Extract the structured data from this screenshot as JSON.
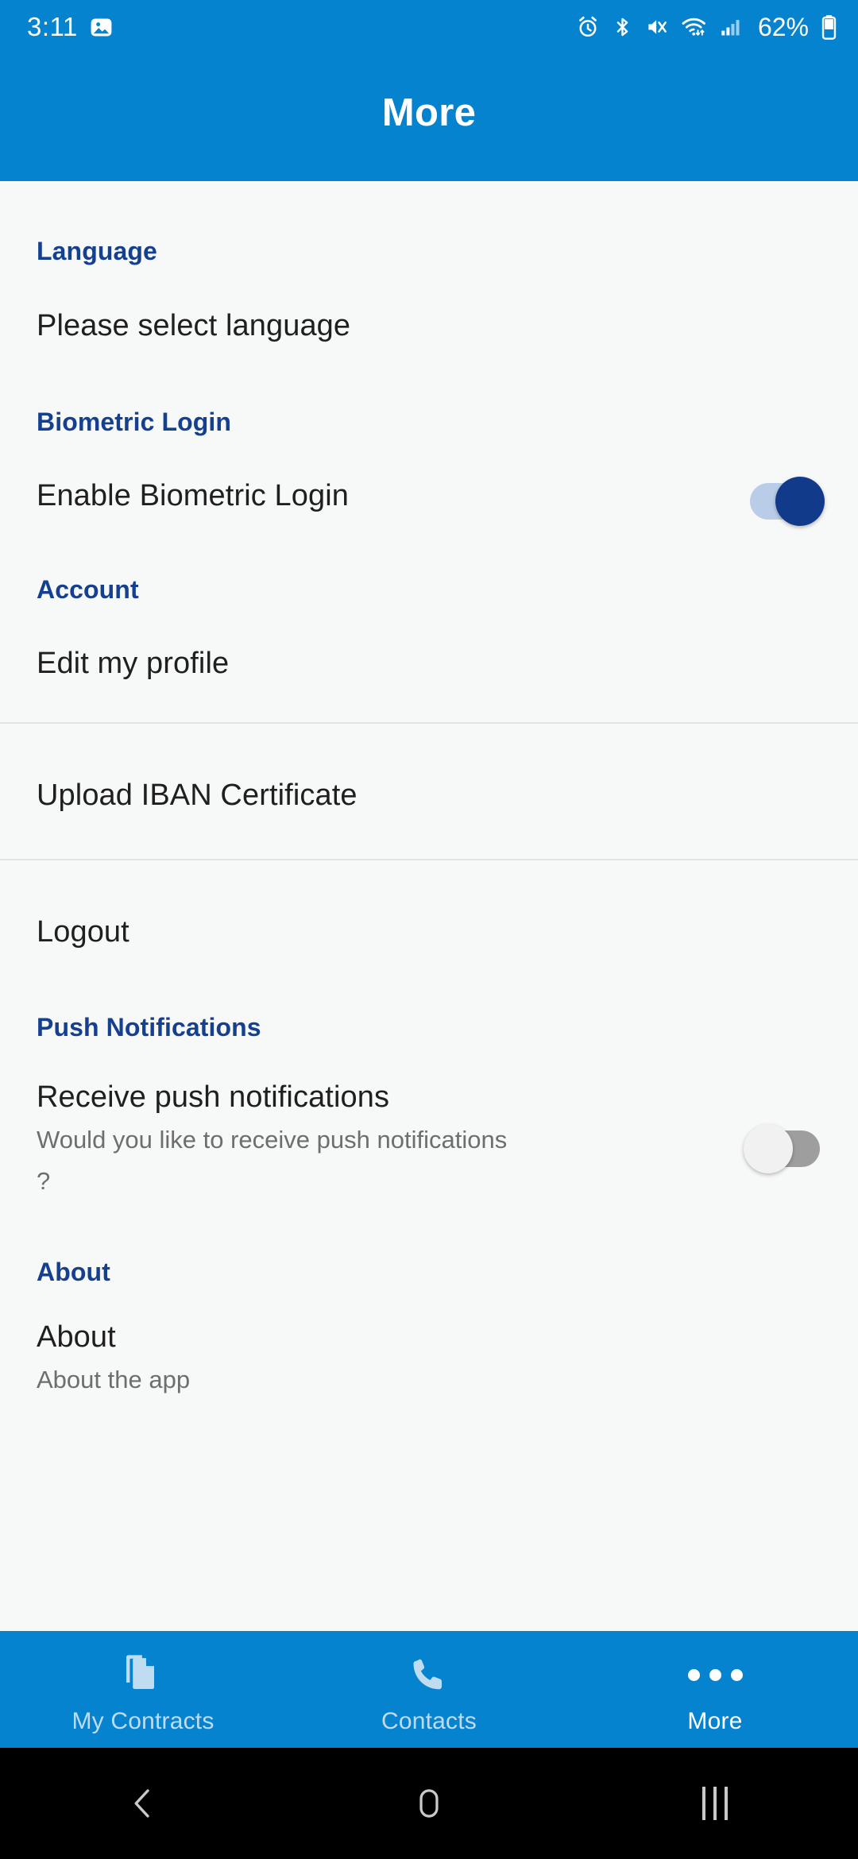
{
  "status_bar": {
    "time": "3:11",
    "battery_percent": "62%",
    "icons": [
      "image-icon",
      "alarm-icon",
      "bluetooth-icon",
      "mute-vibrate-icon",
      "wifi-icon",
      "signal-icon",
      "battery-icon"
    ]
  },
  "app_bar": {
    "title": "More"
  },
  "sections": {
    "language": {
      "header": "Language",
      "item": "Please select language"
    },
    "biometric": {
      "header": "Biometric Login",
      "item": "Enable Biometric Login",
      "toggle_state": "on"
    },
    "account": {
      "header": "Account",
      "items": [
        "Edit my profile",
        "Upload IBAN Certificate",
        "Logout"
      ]
    },
    "push": {
      "header": "Push Notifications",
      "item": "Receive push notifications",
      "subtitle": "Would you like to receive push notifications ?",
      "toggle_state": "off"
    },
    "about": {
      "header": "About",
      "item": "About",
      "subtitle": "About the app"
    }
  },
  "bottom_nav": {
    "items": [
      {
        "label": "My Contracts",
        "icon": "documents-icon",
        "active": false
      },
      {
        "label": "Contacts",
        "icon": "phone-icon",
        "active": false
      },
      {
        "label": "More",
        "icon": "more-dots-icon",
        "active": true
      }
    ]
  },
  "android_nav": {
    "back": "back-icon",
    "home": "home-icon",
    "recents": "recents-icon"
  },
  "colors": {
    "primary_blue": "#0683ce",
    "section_header_blue": "#153f8f",
    "toggle_on_thumb": "#123a8b",
    "toggle_on_track": "#b9cde8",
    "toggle_off_track": "#9e9e9e",
    "background": "#f7f8f8",
    "text_primary": "#1f1f1f",
    "text_secondary": "#6e6e6e"
  }
}
